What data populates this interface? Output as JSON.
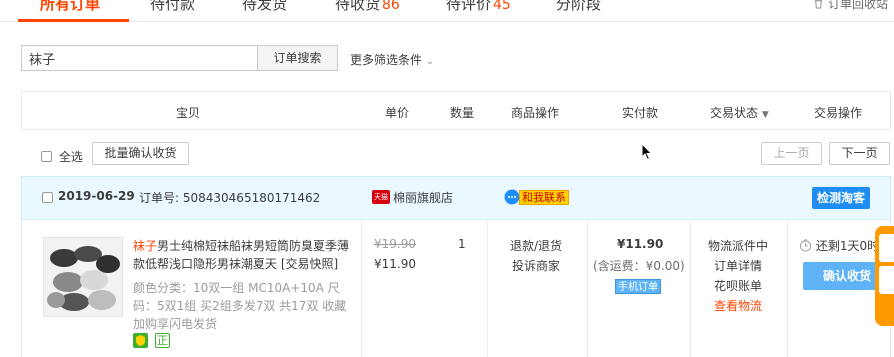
{
  "tabs": [
    {
      "label": "所有订单",
      "count": ""
    },
    {
      "label": "待付款",
      "count": ""
    },
    {
      "label": "待发货",
      "count": ""
    },
    {
      "label": "待收货",
      "count": "86"
    },
    {
      "label": "待评价",
      "count": "45"
    },
    {
      "label": "分阶段",
      "count": ""
    }
  ],
  "recycle_label": "订单回收站",
  "search": {
    "value": "袜子",
    "button": "订单搜索",
    "more_filters": "更多筛选条件"
  },
  "table_headers": {
    "item": "宝贝",
    "price": "单价",
    "qty": "数量",
    "item_ops": "商品操作",
    "paid": "实付款",
    "status": "交易状态",
    "trade_ops": "交易操作"
  },
  "toolbar": {
    "select_all": "全选",
    "batch_confirm": "批量确认收货",
    "prev_page": "上一页",
    "next_page": "下一页"
  },
  "order": {
    "date": "2019-06-29",
    "order_no_label": "订单号: ",
    "order_no": "508430465180171462",
    "shop": "棉丽旗舰店",
    "shop_badge": "天猫",
    "contact": "和我联系",
    "tao_button": "检测淘客",
    "title_highlight": "袜子",
    "title_rest": "男士纯棉短袜船袜男短筒防臭夏季薄款低帮浅口隐形男袜潮夏天 [交易快照]",
    "spec": "颜色分类：10双一组 MC10A+10A  尺码：5双1组 买2组多发7双 共17双 收藏加购享闪电发货",
    "orig_price": "¥19.90",
    "price": "¥11.90",
    "qty": "1",
    "item_op1": "退款/退货",
    "item_op2": "投诉商家",
    "paid": "¥11.90",
    "shipping": "(含运费：¥0.00)",
    "mobile_tag": "手机订单",
    "status1": "物流派件中",
    "status2": "订单详情",
    "status3": "花呗账单",
    "status4": "查看物流",
    "countdown": "还剩1天0时",
    "confirm_button": "确认收货",
    "badge_zheng": "正"
  },
  "colors": {
    "accent": "#ff4400",
    "blue_button": "#1f8df1",
    "light_blue_button": "#5db3f5"
  }
}
